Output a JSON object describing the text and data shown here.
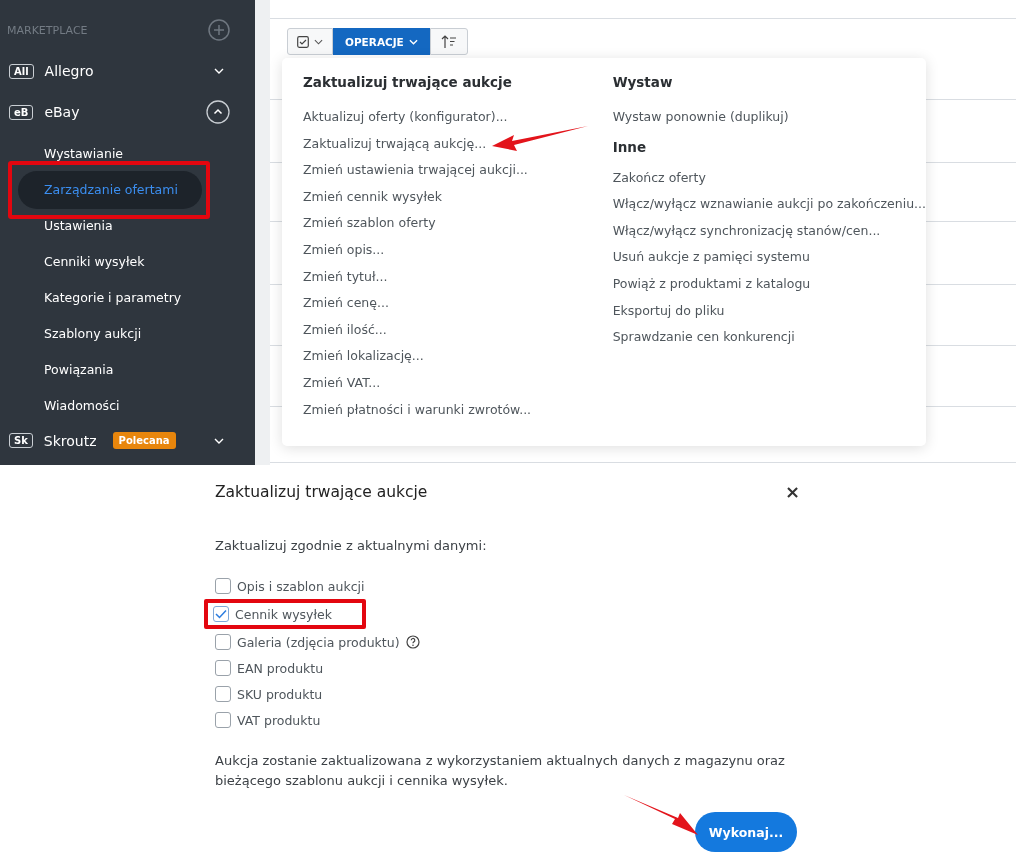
{
  "sidebar": {
    "section_title": "MARKETPLACE",
    "items": [
      {
        "badge": "All",
        "label": "Allegro",
        "expanded": false
      },
      {
        "badge": "eB",
        "label": "eBay",
        "expanded": true,
        "children": [
          {
            "label": "Wystawianie",
            "selected": false,
            "highlighted": false
          },
          {
            "label": "Zarządzanie ofertami",
            "selected": true,
            "highlighted": true
          },
          {
            "label": "Ustawienia",
            "selected": false,
            "highlighted": false
          },
          {
            "label": "Cenniki wysyłek",
            "selected": false,
            "highlighted": false
          },
          {
            "label": "Kategorie i parametry",
            "selected": false,
            "highlighted": false
          },
          {
            "label": "Szablony aukcji",
            "selected": false,
            "highlighted": false
          },
          {
            "label": "Powiązania",
            "selected": false,
            "highlighted": false
          },
          {
            "label": "Wiadomości",
            "selected": false,
            "highlighted": false
          }
        ]
      },
      {
        "badge": "Sk",
        "label": "Skroutz",
        "tag": "Polecana",
        "expanded": false
      }
    ]
  },
  "toolbar": {
    "operations_label": "OPERACJE"
  },
  "operations_menu": {
    "columns": [
      {
        "groups": [
          {
            "title": "Zaktualizuj trwające aukcje",
            "items": [
              {
                "label": "Aktualizuj oferty (konfigurator)...",
                "pointed": false
              },
              {
                "label": "Zaktualizuj trwającą aukcję...",
                "pointed": true
              },
              {
                "label": "Zmień ustawienia trwającej aukcji...",
                "pointed": false
              },
              {
                "label": "Zmień cennik wysyłek",
                "pointed": false
              },
              {
                "label": "Zmień szablon oferty",
                "pointed": false
              },
              {
                "label": "Zmień opis...",
                "pointed": false
              },
              {
                "label": "Zmień tytuł...",
                "pointed": false
              },
              {
                "label": "Zmień cenę...",
                "pointed": false
              },
              {
                "label": "Zmień ilość...",
                "pointed": false
              },
              {
                "label": "Zmień lokalizację...",
                "pointed": false
              },
              {
                "label": "Zmień VAT...",
                "pointed": false
              },
              {
                "label": "Zmień płatności i warunki zwrotów...",
                "pointed": false
              }
            ]
          }
        ]
      },
      {
        "groups": [
          {
            "title": "Wystaw",
            "items": [
              {
                "label": "Wystaw ponownie (duplikuj)",
                "pointed": false
              }
            ]
          },
          {
            "title": "Inne",
            "items": [
              {
                "label": "Zakończ oferty",
                "pointed": false
              },
              {
                "label": "Włącz/wyłącz wznawianie aukcji po zakończeniu...",
                "pointed": false
              },
              {
                "label": "Włącz/wyłącz synchronizację stanów/cen...",
                "pointed": false
              },
              {
                "label": "Usuń aukcje z pamięci systemu",
                "pointed": false
              },
              {
                "label": "Powiąż z produktami z katalogu",
                "pointed": false
              },
              {
                "label": "Eksportuj do pliku",
                "pointed": false
              },
              {
                "label": "Sprawdzanie cen konkurencji",
                "pointed": false
              }
            ]
          }
        ]
      }
    ]
  },
  "dialog": {
    "title": "Zaktualizuj trwające aukcje",
    "close": "×",
    "subtitle": "Zaktualizuj zgodnie z aktualnymi danymi:",
    "options": [
      {
        "label": "Opis i szablon aukcji",
        "checked": false,
        "highlighted": false,
        "help": false
      },
      {
        "label": "Cennik wysyłek",
        "checked": true,
        "highlighted": true,
        "help": false
      },
      {
        "label": "Galeria (zdjęcia produktu)",
        "checked": false,
        "highlighted": false,
        "help": true
      },
      {
        "label": "EAN produktu",
        "checked": false,
        "highlighted": false,
        "help": false
      },
      {
        "label": "SKU produktu",
        "checked": false,
        "highlighted": false,
        "help": false
      },
      {
        "label": "VAT produktu",
        "checked": false,
        "highlighted": false,
        "help": false
      }
    ],
    "note": "Aukcja zostanie zaktualizowana z wykorzystaniem aktualnych danych z magazynu oraz bieżącego szablonu aukcji i cennika wysyłek.",
    "submit": {
      "label": "Wykonaj...",
      "pointed": true
    }
  }
}
